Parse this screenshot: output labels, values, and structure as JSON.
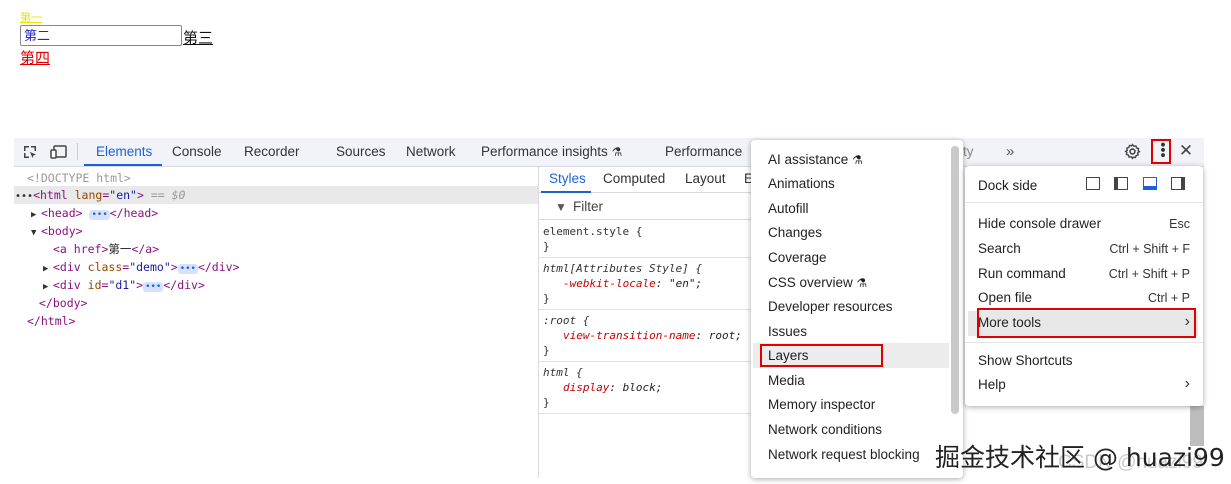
{
  "page": {
    "link1": "第一",
    "input_value": "第二",
    "link3": "第三",
    "link4": "第四"
  },
  "devtools": {
    "tabs": [
      "Elements",
      "Console",
      "Recorder",
      "Sources",
      "Network",
      "Performance insights",
      "Performance"
    ],
    "tab_hidden_fragment": "ty",
    "more_tabs": "»",
    "tree": {
      "doctype": "<!DOCTYPE html>",
      "html_open_tag": "<html",
      "html_attr": "lang",
      "html_val": "\"en\"",
      "html_close": ">",
      "sel_marker": "== $0",
      "head": "<head>",
      "head_close": "</head>",
      "body": "<body>",
      "a_open": "<a href>",
      "a_text": "第一",
      "a_close": "</a>",
      "div1_open": "<div",
      "div1_attr": "class",
      "div1_val": "\"demo\"",
      "div_gt": ">",
      "div_close": "</div>",
      "div2_attr": "id",
      "div2_val": "\"d1\"",
      "body_close": "</body>",
      "html_end": "</html>"
    },
    "styles_tabs": [
      "Styles",
      "Computed",
      "Layout",
      "E"
    ],
    "filter_placeholder": "Filter",
    "rules": {
      "r1_sel": "element.style {",
      "r1_end": "}",
      "r2_sel": "html[Attributes Style] {",
      "r2_prop": "-webkit-locale",
      "r2_val": "\"en\";",
      "r2_end": "}",
      "r3_sel": ":root {",
      "r3_prop": "view-transition-name",
      "r3_val": "root;",
      "r3_end": "}",
      "r4_sel": "html {",
      "r4_prop": "display",
      "r4_val": "block;",
      "r4_end": "}"
    }
  },
  "more_tools_menu": {
    "items": [
      "AI assistance",
      "Animations",
      "Autofill",
      "Changes",
      "Coverage",
      "CSS overview",
      "Developer resources",
      "Issues",
      "Layers",
      "Media",
      "Memory inspector",
      "Network conditions",
      "Network request blocking"
    ],
    "highlighted": "Layers"
  },
  "main_menu": {
    "dock_side_label": "Dock side",
    "items": [
      {
        "label": "Hide console drawer",
        "shortcut": "Esc"
      },
      {
        "label": "Search",
        "shortcut": "Ctrl + Shift + F"
      },
      {
        "label": "Run command",
        "shortcut": "Ctrl + Shift + P"
      },
      {
        "label": "Open file",
        "shortcut": "Ctrl + P"
      },
      {
        "label": "More tools",
        "shortcut": "›"
      },
      {
        "label": "Show Shortcuts",
        "shortcut": ""
      },
      {
        "label": "Help",
        "shortcut": "›"
      }
    ]
  },
  "watermark": "掘金技术社区 @ huazi99",
  "watermark_bg": "CSDN @huazi99",
  "colors": {
    "accent": "#1a62d6",
    "highlight_box": "#e00000",
    "tag": "#881280"
  }
}
